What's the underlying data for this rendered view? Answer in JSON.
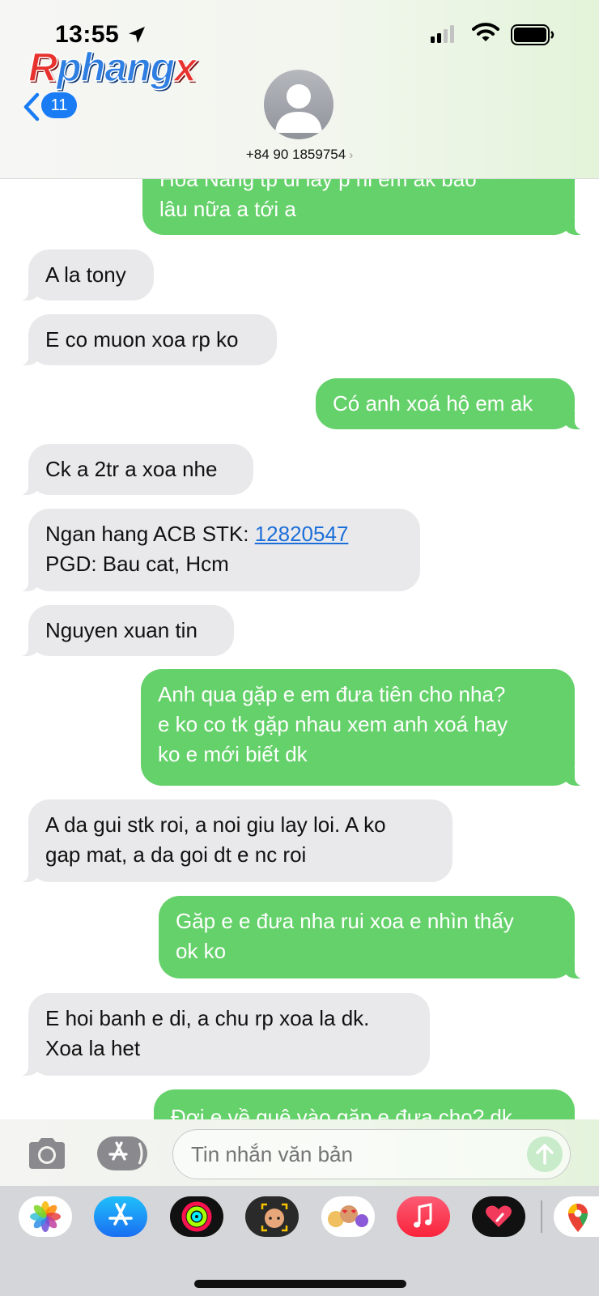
{
  "status_bar": {
    "time": "13:55"
  },
  "watermark": {
    "part1": "R",
    "part2": "phang",
    "part3": "x"
  },
  "header": {
    "back_count": "11",
    "contact_number": "+84 90 1859754",
    "chevron": "›"
  },
  "messages": [
    {
      "type": "sent",
      "lines": [
        "Hoa Nang  tp di lay p hi em ak  bao",
        "lâu nữa a tới a"
      ]
    },
    {
      "type": "received",
      "lines": [
        "A la tony"
      ]
    },
    {
      "type": "received",
      "lines": [
        "E co muon xoa rp ko"
      ]
    },
    {
      "type": "sent",
      "lines": [
        "Có anh xoá hộ em ak"
      ]
    },
    {
      "type": "received",
      "lines": [
        "Ck a 2tr a xoa nhe"
      ]
    },
    {
      "type": "received",
      "lines": [
        " Ngan hang ACB STK: ",
        "PGD: Bau cat, Hcm"
      ],
      "link": "12820547"
    },
    {
      "type": "received",
      "lines": [
        "Nguyen xuan tin"
      ]
    },
    {
      "type": "sent",
      "lines": [
        "Anh qua gặp e em đưa tiên cho nha?",
        "e ko co tk gặp nhau xem anh xoá hay",
        "ko e mới biết dk"
      ]
    },
    {
      "type": "received",
      "lines": [
        "A da gui stk roi, a noi giu lay loi. A ko",
        "gap mat, a da goi dt e nc roi"
      ]
    },
    {
      "type": "sent",
      "lines": [
        "Găp e e đưa nha rui xoa e nhìn thấy",
        "ok ko"
      ]
    },
    {
      "type": "received",
      "lines": [
        "E hoi banh e di, a chu rp xoa la dk.",
        "Xoa la het"
      ]
    },
    {
      "type": "sent",
      "lines": [
        "Đợi e về quê vào gặp e đưa cho? dk"
      ]
    }
  ],
  "composer": {
    "placeholder": "Tin nhắn văn bản"
  },
  "app_tray": [
    "photos-icon",
    "app-store-icon",
    "fitness-icon",
    "memoji-icon",
    "memoji-stickers-icon",
    "music-icon",
    "digital-touch-icon",
    "google-maps-icon"
  ],
  "colors": {
    "sent_bubble": "#65d16a",
    "received_bubble": "#e9e9eb",
    "link": "#1c6fd8",
    "badge": "#1a7cf5"
  }
}
